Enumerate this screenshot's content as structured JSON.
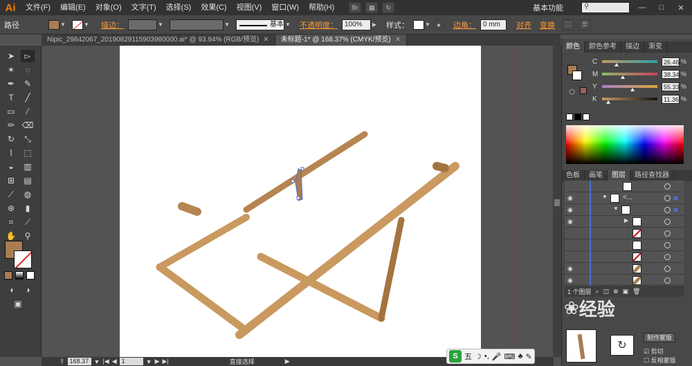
{
  "app": {
    "logo": "Ai",
    "menus": [
      "文件(F)",
      "编辑(E)",
      "对象(O)",
      "文字(T)",
      "选择(S)",
      "效果(C)",
      "视图(V)",
      "窗口(W)",
      "帮助(H)"
    ],
    "menu_icon_br": "Br",
    "workspace": "基本功能",
    "search_placeholder": ""
  },
  "control_bar": {
    "selection_label": "路径",
    "fill_color": "#a87d52",
    "stroke_label": "描边：",
    "stroke_style_label": "基本",
    "opacity_label": "不透明度：",
    "opacity_value": "100%",
    "style_label": "样式：",
    "corner_label": "边角：",
    "corner_value": "0 mm",
    "align_label": "对齐",
    "transform_label": "变换"
  },
  "tabs": [
    {
      "label": "Nipic_29842067_20190829115903980000.ai* @ 93.94% (RGB/预览)",
      "close": "✕"
    },
    {
      "label": "未标题-1* @ 168.37% (CMYK/预览)",
      "close": "✕"
    }
  ],
  "status_bar": {
    "zoom": "168.37",
    "page": "1",
    "tool_name": "直接选择"
  },
  "color_panel": {
    "tabs": [
      "颜色",
      "颜色参考",
      "描边",
      "渐变"
    ],
    "channels": [
      {
        "label": "C",
        "value": "26.46",
        "pct": "%",
        "pos": 0.26
      },
      {
        "label": "M",
        "value": "38.34",
        "pct": "%",
        "pos": 0.38
      },
      {
        "label": "Y",
        "value": "55.33",
        "pct": "%",
        "pos": 0.55
      },
      {
        "label": "K",
        "value": "11.36",
        "pct": "%",
        "pos": 0.11
      }
    ],
    "fill_color": "#a87d52"
  },
  "layers_panel": {
    "tabs": [
      "色板",
      "画笔",
      "图层",
      "路径查找器"
    ],
    "footer_text": "1 个图层",
    "rows": [
      {
        "eye": false,
        "indent": 0,
        "tri": "",
        "thumb": "blank",
        "name": ""
      },
      {
        "eye": true,
        "indent": 0,
        "tri": "▼",
        "thumb": "line",
        "name": "<...",
        "selected": true
      },
      {
        "eye": true,
        "indent": 1,
        "tri": "▼",
        "thumb": "line",
        "name": "",
        "selected": true
      },
      {
        "eye": true,
        "indent": 2,
        "tri": "▶",
        "thumb": "line",
        "name": ""
      },
      {
        "eye": false,
        "indent": 3,
        "tri": "",
        "thumb": "red",
        "name": ""
      },
      {
        "eye": false,
        "indent": 3,
        "tri": "",
        "thumb": "blank",
        "name": ""
      },
      {
        "eye": false,
        "indent": 3,
        "tri": "",
        "thumb": "red",
        "name": ""
      },
      {
        "eye": true,
        "indent": 3,
        "tri": "",
        "thumb": "wood",
        "name": ""
      },
      {
        "eye": true,
        "indent": 3,
        "tri": "",
        "thumb": "wood",
        "name": ""
      }
    ]
  },
  "bottom_panel": {
    "make_mask": "制作蒙版",
    "clip": "剪切",
    "invert_mask": "反相蒙版"
  },
  "ime": {
    "logo": "S",
    "mode": "五"
  },
  "watermark": "经验"
}
